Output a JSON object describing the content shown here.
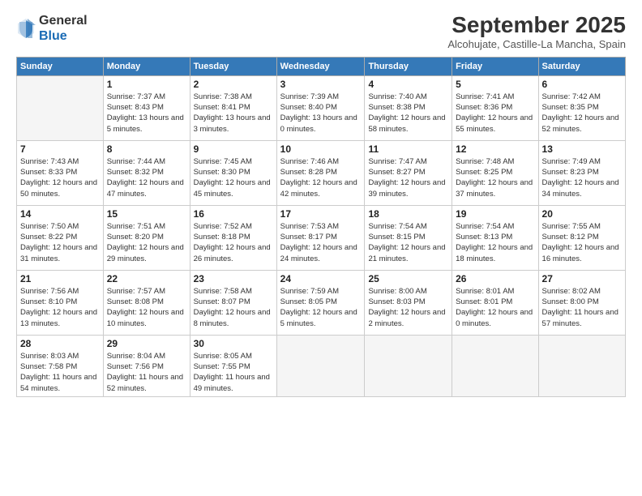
{
  "logo": {
    "general": "General",
    "blue": "Blue"
  },
  "header": {
    "month": "September 2025",
    "location": "Alcohujate, Castille-La Mancha, Spain"
  },
  "days_of_week": [
    "Sunday",
    "Monday",
    "Tuesday",
    "Wednesday",
    "Thursday",
    "Friday",
    "Saturday"
  ],
  "weeks": [
    [
      {
        "day": null
      },
      {
        "day": 1,
        "sunrise": "7:37 AM",
        "sunset": "8:43 PM",
        "daylight": "13 hours and 5 minutes."
      },
      {
        "day": 2,
        "sunrise": "7:38 AM",
        "sunset": "8:41 PM",
        "daylight": "13 hours and 3 minutes."
      },
      {
        "day": 3,
        "sunrise": "7:39 AM",
        "sunset": "8:40 PM",
        "daylight": "13 hours and 0 minutes."
      },
      {
        "day": 4,
        "sunrise": "7:40 AM",
        "sunset": "8:38 PM",
        "daylight": "12 hours and 58 minutes."
      },
      {
        "day": 5,
        "sunrise": "7:41 AM",
        "sunset": "8:36 PM",
        "daylight": "12 hours and 55 minutes."
      },
      {
        "day": 6,
        "sunrise": "7:42 AM",
        "sunset": "8:35 PM",
        "daylight": "12 hours and 52 minutes."
      }
    ],
    [
      {
        "day": 7,
        "sunrise": "7:43 AM",
        "sunset": "8:33 PM",
        "daylight": "12 hours and 50 minutes."
      },
      {
        "day": 8,
        "sunrise": "7:44 AM",
        "sunset": "8:32 PM",
        "daylight": "12 hours and 47 minutes."
      },
      {
        "day": 9,
        "sunrise": "7:45 AM",
        "sunset": "8:30 PM",
        "daylight": "12 hours and 45 minutes."
      },
      {
        "day": 10,
        "sunrise": "7:46 AM",
        "sunset": "8:28 PM",
        "daylight": "12 hours and 42 minutes."
      },
      {
        "day": 11,
        "sunrise": "7:47 AM",
        "sunset": "8:27 PM",
        "daylight": "12 hours and 39 minutes."
      },
      {
        "day": 12,
        "sunrise": "7:48 AM",
        "sunset": "8:25 PM",
        "daylight": "12 hours and 37 minutes."
      },
      {
        "day": 13,
        "sunrise": "7:49 AM",
        "sunset": "8:23 PM",
        "daylight": "12 hours and 34 minutes."
      }
    ],
    [
      {
        "day": 14,
        "sunrise": "7:50 AM",
        "sunset": "8:22 PM",
        "daylight": "12 hours and 31 minutes."
      },
      {
        "day": 15,
        "sunrise": "7:51 AM",
        "sunset": "8:20 PM",
        "daylight": "12 hours and 29 minutes."
      },
      {
        "day": 16,
        "sunrise": "7:52 AM",
        "sunset": "8:18 PM",
        "daylight": "12 hours and 26 minutes."
      },
      {
        "day": 17,
        "sunrise": "7:53 AM",
        "sunset": "8:17 PM",
        "daylight": "12 hours and 24 minutes."
      },
      {
        "day": 18,
        "sunrise": "7:54 AM",
        "sunset": "8:15 PM",
        "daylight": "12 hours and 21 minutes."
      },
      {
        "day": 19,
        "sunrise": "7:54 AM",
        "sunset": "8:13 PM",
        "daylight": "12 hours and 18 minutes."
      },
      {
        "day": 20,
        "sunrise": "7:55 AM",
        "sunset": "8:12 PM",
        "daylight": "12 hours and 16 minutes."
      }
    ],
    [
      {
        "day": 21,
        "sunrise": "7:56 AM",
        "sunset": "8:10 PM",
        "daylight": "12 hours and 13 minutes."
      },
      {
        "day": 22,
        "sunrise": "7:57 AM",
        "sunset": "8:08 PM",
        "daylight": "12 hours and 10 minutes."
      },
      {
        "day": 23,
        "sunrise": "7:58 AM",
        "sunset": "8:07 PM",
        "daylight": "12 hours and 8 minutes."
      },
      {
        "day": 24,
        "sunrise": "7:59 AM",
        "sunset": "8:05 PM",
        "daylight": "12 hours and 5 minutes."
      },
      {
        "day": 25,
        "sunrise": "8:00 AM",
        "sunset": "8:03 PM",
        "daylight": "12 hours and 2 minutes."
      },
      {
        "day": 26,
        "sunrise": "8:01 AM",
        "sunset": "8:01 PM",
        "daylight": "12 hours and 0 minutes."
      },
      {
        "day": 27,
        "sunrise": "8:02 AM",
        "sunset": "8:00 PM",
        "daylight": "11 hours and 57 minutes."
      }
    ],
    [
      {
        "day": 28,
        "sunrise": "8:03 AM",
        "sunset": "7:58 PM",
        "daylight": "11 hours and 54 minutes."
      },
      {
        "day": 29,
        "sunrise": "8:04 AM",
        "sunset": "7:56 PM",
        "daylight": "11 hours and 52 minutes."
      },
      {
        "day": 30,
        "sunrise": "8:05 AM",
        "sunset": "7:55 PM",
        "daylight": "11 hours and 49 minutes."
      },
      {
        "day": null
      },
      {
        "day": null
      },
      {
        "day": null
      },
      {
        "day": null
      }
    ]
  ]
}
